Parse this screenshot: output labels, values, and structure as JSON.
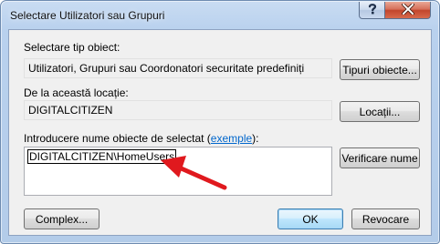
{
  "window": {
    "title": "Selectare Utilizatori sau Grupuri"
  },
  "titlebar": {
    "help_icon": "question-mark-icon",
    "close_icon": "close-x-icon"
  },
  "object_type": {
    "label": "Selectare tip obiect:",
    "value": "Utilizatori, Grupuri sau Coordonatori securitate predefiniți",
    "button": "Tipuri obiecte..."
  },
  "location": {
    "label": "De la această locație:",
    "value": "DIGITALCITIZEN",
    "button": "Locații..."
  },
  "object_names": {
    "label_before": "Introducere nume obiecte de selectat (",
    "link": "exemple",
    "label_after": "):",
    "value": "DIGITALCITIZEN\\HomeUsers",
    "check_button": "Verificare nume"
  },
  "footer": {
    "advanced_button": "Complex...",
    "ok_button": "OK",
    "cancel_button": "Revocare"
  },
  "annotation": {
    "arrow_color": "#e0191e",
    "icon": "red-arrow-icon"
  }
}
